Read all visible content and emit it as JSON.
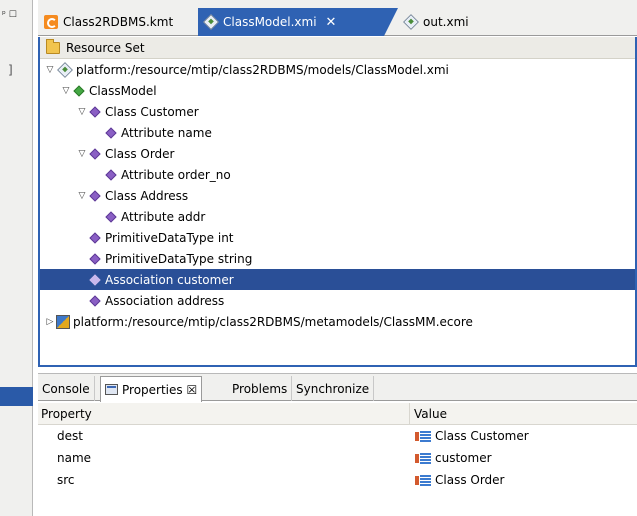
{
  "left_panel": {
    "controls": "ᵖ ☐",
    "mark": "]"
  },
  "editor_tabs": [
    {
      "label": "Class2RDBMS.kmt",
      "icon": "kermeta-file-icon",
      "active": false
    },
    {
      "label": "ClassModel.xmi",
      "icon": "xmi-file-icon",
      "active": true,
      "close": "✕"
    },
    {
      "label": "out.xmi",
      "icon": "xmi-file-icon",
      "active": false
    }
  ],
  "editor": {
    "header": "Resource Set",
    "tree": [
      {
        "twisty": "▽",
        "icon": "xmi-file-icon",
        "label": "platform:/resource/mtip/class2RDBMS/models/ClassModel.xmi"
      },
      {
        "twisty": "▽",
        "icon": "green-diamond-icon",
        "label": "ClassModel"
      },
      {
        "twisty": "▽",
        "icon": "diamond-icon",
        "label": "Class Customer"
      },
      {
        "twisty": "",
        "icon": "diamond-icon",
        "label": "Attribute name"
      },
      {
        "twisty": "▽",
        "icon": "diamond-icon",
        "label": "Class Order"
      },
      {
        "twisty": "",
        "icon": "diamond-icon",
        "label": "Attribute order_no"
      },
      {
        "twisty": "▽",
        "icon": "diamond-icon",
        "label": "Class Address"
      },
      {
        "twisty": "",
        "icon": "diamond-icon",
        "label": "Attribute addr"
      },
      {
        "twisty": "",
        "icon": "diamond-icon",
        "label": "PrimitiveDataType int"
      },
      {
        "twisty": "",
        "icon": "diamond-icon",
        "label": "PrimitiveDataType string"
      },
      {
        "twisty": "",
        "icon": "diamond-icon",
        "label": "Association customer",
        "selected": true
      },
      {
        "twisty": "",
        "icon": "diamond-icon",
        "label": "Association address"
      },
      {
        "twisty": "▷",
        "icon": "ecore-package-icon",
        "label": "platform:/resource/mtip/class2RDBMS/metamodels/ClassMM.ecore"
      }
    ]
  },
  "bottom_tabs": [
    {
      "label": "Console"
    },
    {
      "label": "Properties ☒",
      "active": true
    },
    {
      "label": "Problems"
    },
    {
      "label": "Synchronize"
    }
  ],
  "properties": {
    "headers": {
      "property": "Property",
      "value": "Value"
    },
    "rows": [
      {
        "property": "dest",
        "value": "Class Customer"
      },
      {
        "property": "name",
        "value": "customer"
      },
      {
        "property": "src",
        "value": "Class Order"
      }
    ]
  },
  "colors": {
    "accent": "#2f62b3",
    "selection": "#2a4f97"
  }
}
